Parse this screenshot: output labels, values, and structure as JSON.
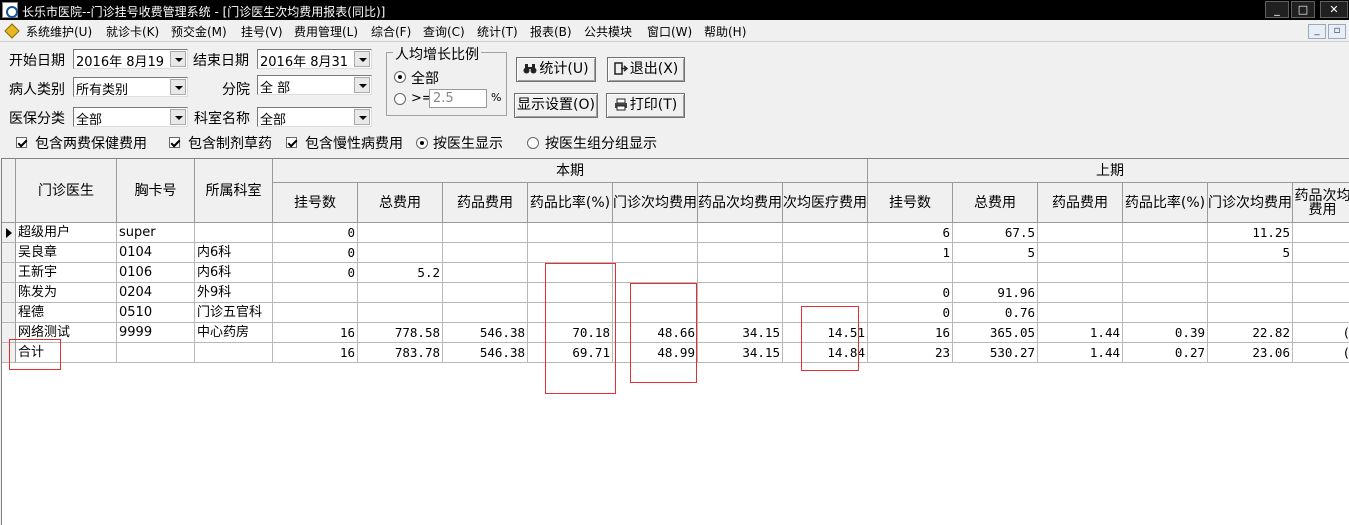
{
  "window": {
    "title": "长乐市医院--门诊挂号收费管理系统 - [门诊医生次均费用报表(同比)]",
    "buttons": [
      "_",
      "□",
      "✕"
    ]
  },
  "menu": [
    "系统维护(U)",
    "就诊卡(K)",
    "预交金(M)",
    "挂号(V)",
    "费用管理(L)",
    "综合(F)",
    "查询(C)",
    "统计(T)",
    "报表(B)",
    "公共模块",
    "窗口(W)",
    "帮助(H)"
  ],
  "filters": {
    "start_date_label": "开始日期",
    "start_date": "2016年  8月19",
    "end_date_label": "结束日期",
    "end_date": "2016年  8月31",
    "patient_type_label": "病人类别",
    "patient_type": "所有类别",
    "branch_label": "分院",
    "branch": "全 部",
    "insurance_label": "医保分类",
    "insurance": "全部",
    "dept_label": "科室名称",
    "dept": "全部"
  },
  "growth": {
    "title": "人均增长比例",
    "all_label": "全部",
    "ge_label": ">=",
    "ge_value": "2.5",
    "unit": "%"
  },
  "buttons": {
    "stats": "统计(U)",
    "exit": "退出(X)",
    "display": "显示设置(O)",
    "print": "打印(T)"
  },
  "options": {
    "include_two_fees": "包含两费保健费用",
    "include_herbal": "包含制剂草药",
    "include_chronic": "包含慢性病费用",
    "by_doctor": "按医生显示",
    "by_group": "按医生组分组显示"
  },
  "table": {
    "fixed_headers": [
      "门诊医生",
      "胸卡号",
      "所属科室"
    ],
    "group_current": "本期",
    "group_previous": "上期",
    "current_headers": [
      "挂号数",
      "总费用",
      "药品费用",
      "药品比率(%)",
      "门诊次均费用",
      "药品次均费用",
      "次均医疗费用"
    ],
    "previous_headers": [
      "挂号数",
      "总费用",
      "药品费用",
      "药品比率(%)",
      "门诊次均费用",
      "药品次均费用"
    ],
    "rows": [
      {
        "doctor": "超级用户",
        "card": "super",
        "dept": "",
        "c": [
          "0",
          "",
          "",
          "",
          "",
          "",
          ""
        ],
        "p": [
          "6",
          "67.5",
          "",
          "",
          "11.25",
          ""
        ]
      },
      {
        "doctor": "吴良章",
        "card": "0104",
        "dept": "内6科",
        "c": [
          "0",
          "",
          "",
          "",
          "",
          "",
          ""
        ],
        "p": [
          "1",
          "5",
          "",
          "",
          "5",
          ""
        ]
      },
      {
        "doctor": "王新宇",
        "card": "0106",
        "dept": "内6科",
        "c": [
          "0",
          "5.2",
          "",
          "",
          "",
          "",
          ""
        ],
        "p": [
          "",
          "",
          "",
          "",
          "",
          ""
        ]
      },
      {
        "doctor": "陈发为",
        "card": "0204",
        "dept": "外9科",
        "c": [
          "",
          "",
          "",
          "",
          "",
          "",
          ""
        ],
        "p": [
          "0",
          "91.96",
          "",
          "",
          "",
          ""
        ]
      },
      {
        "doctor": "程德",
        "card": "0510",
        "dept": "门诊五官科",
        "c": [
          "",
          "",
          "",
          "",
          "",
          "",
          ""
        ],
        "p": [
          "0",
          "0.76",
          "",
          "",
          "",
          ""
        ]
      },
      {
        "doctor": "网络测试",
        "card": "9999",
        "dept": "中心药房",
        "c": [
          "16",
          "778.58",
          "546.38",
          "70.18",
          "48.66",
          "34.15",
          "14.51"
        ],
        "p": [
          "16",
          "365.05",
          "1.44",
          "0.39",
          "22.82",
          "("
        ]
      },
      {
        "doctor": "合计",
        "card": "",
        "dept": "",
        "c": [
          "16",
          "783.78",
          "546.38",
          "69.71",
          "48.99",
          "34.15",
          "14.84"
        ],
        "p": [
          "23",
          "530.27",
          "1.44",
          "0.27",
          "23.06",
          "("
        ]
      }
    ]
  },
  "colors": {
    "titlebar": "#000000",
    "highlight_box": "#e23030",
    "window_bg": "#f0f0f0"
  }
}
